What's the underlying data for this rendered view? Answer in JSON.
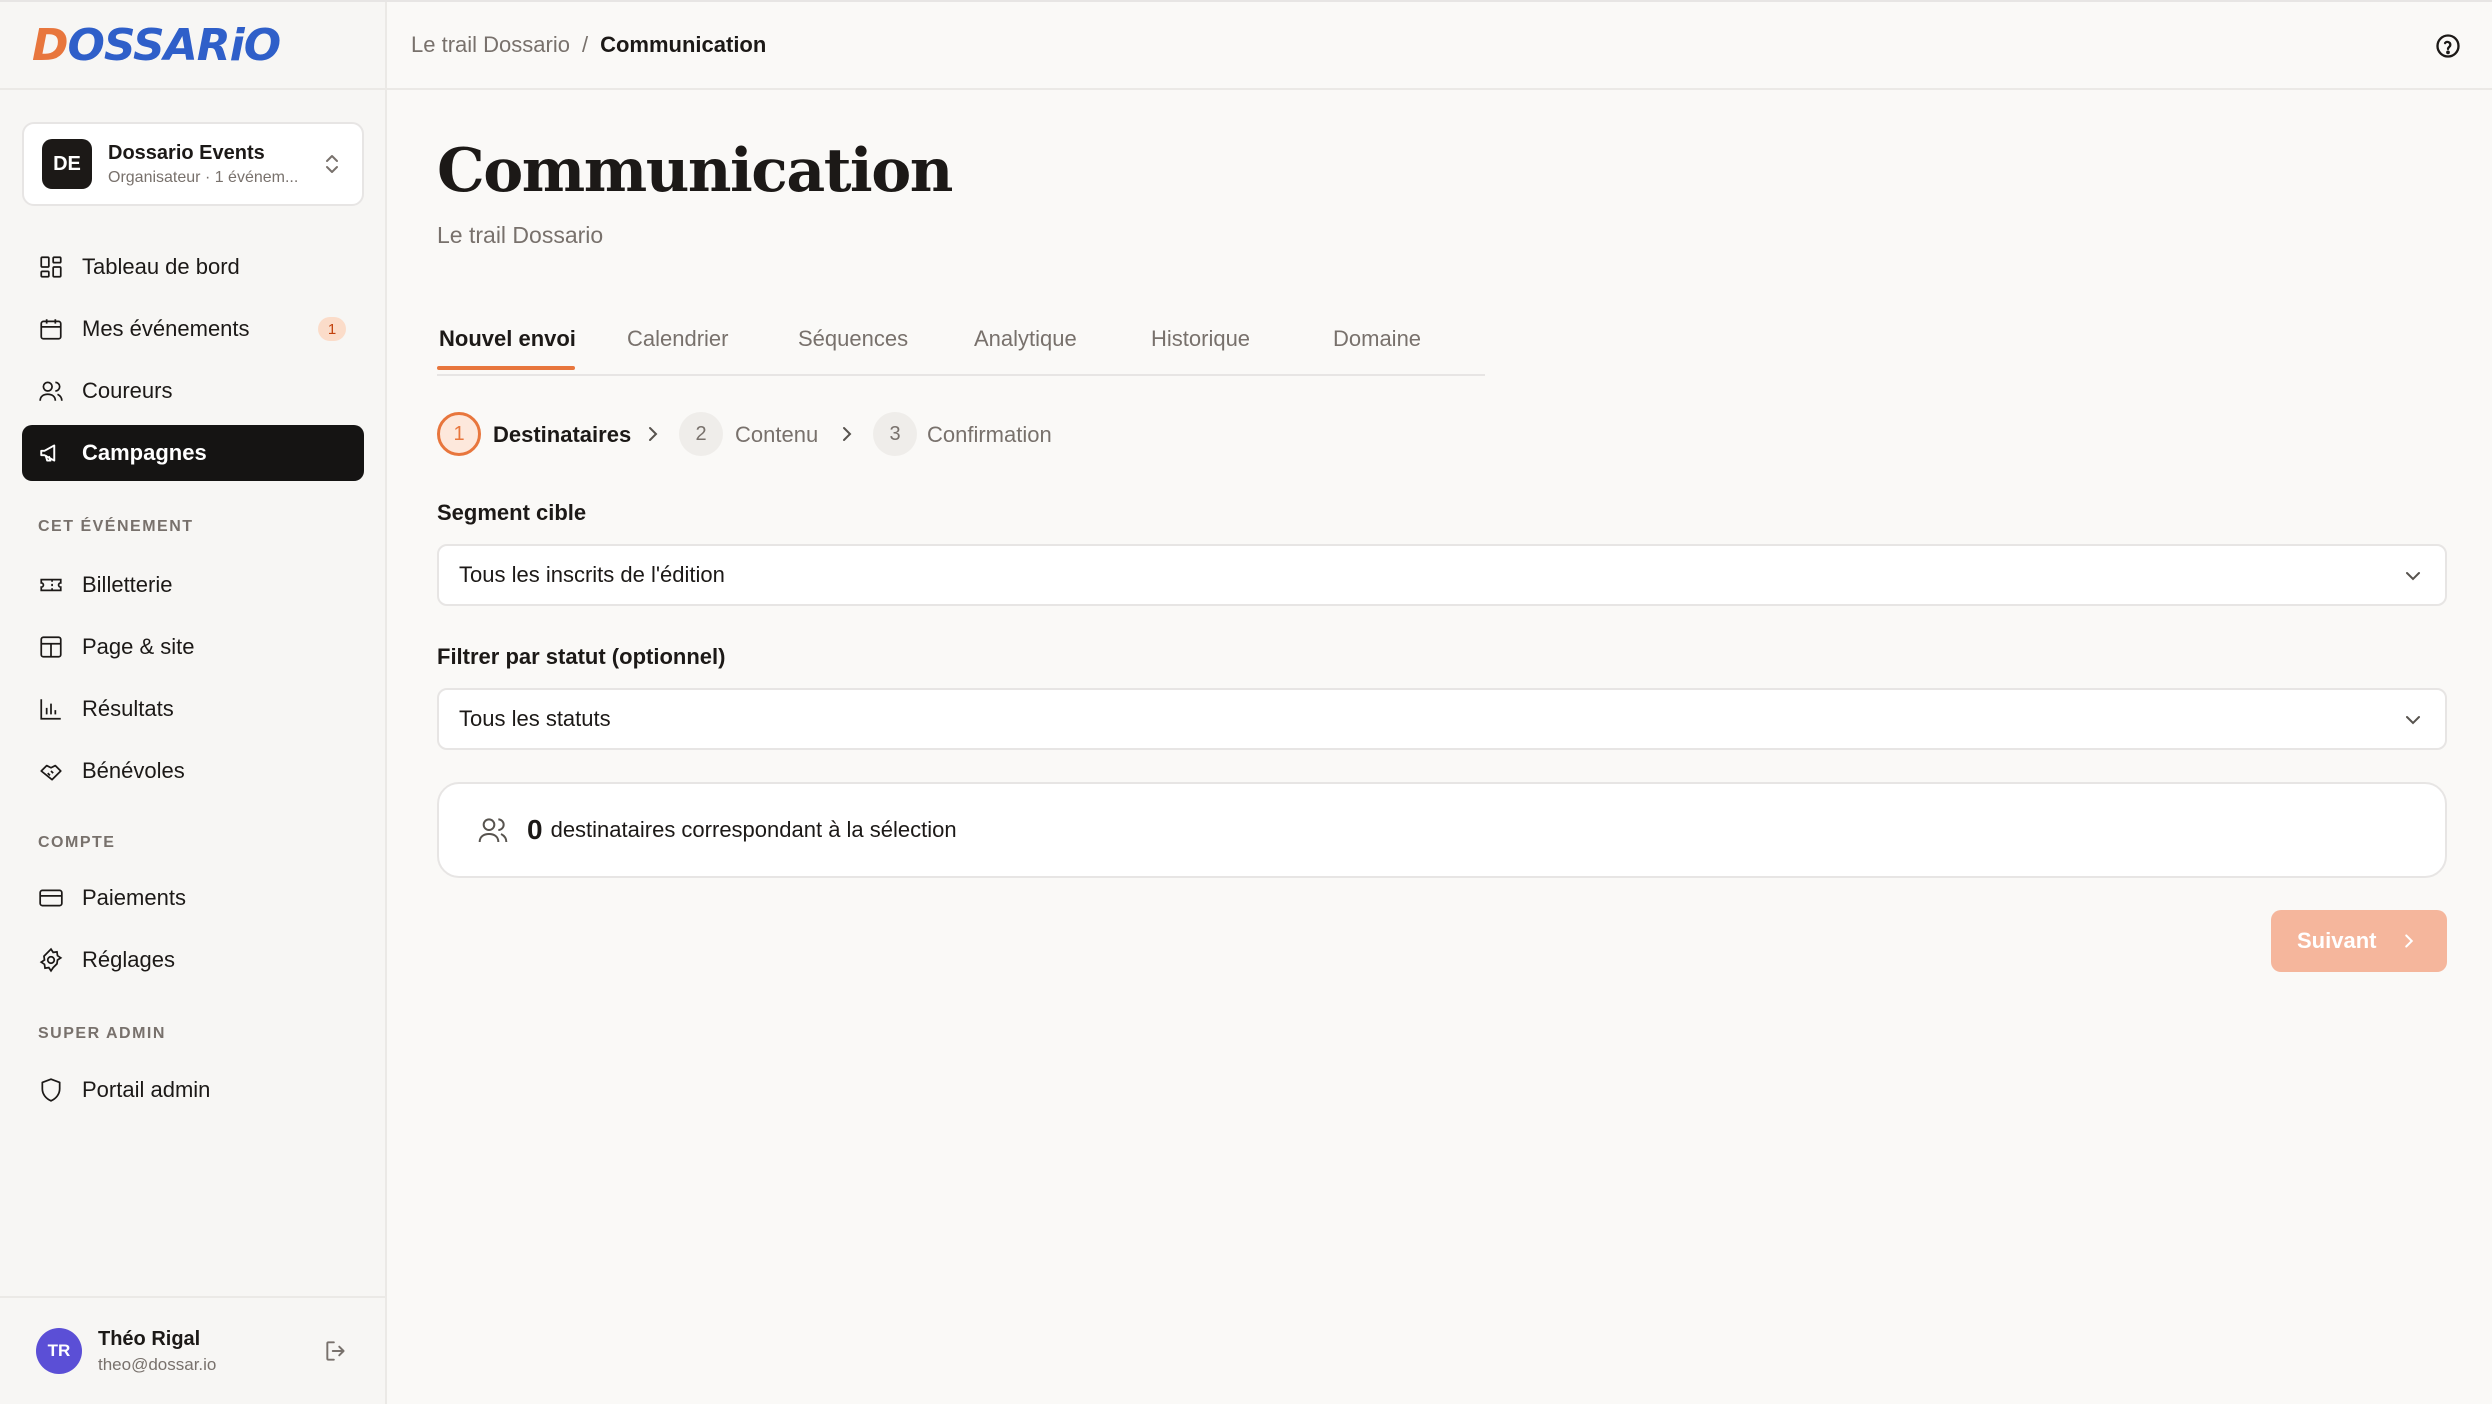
{
  "brand": {
    "logo_prefix": "D",
    "logo_rest": "OSSARiO"
  },
  "org": {
    "initials": "DE",
    "name": "Dossario Events",
    "subtitle": "Organisateur · 1 événem..."
  },
  "nav": {
    "main": [
      {
        "label": "Tableau de bord",
        "icon": "dashboard-icon"
      },
      {
        "label": "Mes événements",
        "icon": "calendar-icon",
        "badge": "1"
      },
      {
        "label": "Coureurs",
        "icon": "users-icon"
      },
      {
        "label": "Campagnes",
        "icon": "megaphone-icon",
        "active": true
      }
    ],
    "event_section_label": "CET ÉVÉNEMENT",
    "event": [
      {
        "label": "Billetterie",
        "icon": "ticket-icon"
      },
      {
        "label": "Page & site",
        "icon": "layout-icon"
      },
      {
        "label": "Résultats",
        "icon": "bar-chart-icon"
      },
      {
        "label": "Bénévoles",
        "icon": "handshake-icon"
      }
    ],
    "account_section_label": "COMPTE",
    "account": [
      {
        "label": "Paiements",
        "icon": "credit-card-icon"
      },
      {
        "label": "Réglages",
        "icon": "settings-icon"
      }
    ],
    "admin_section_label": "SUPER ADMIN",
    "admin": [
      {
        "label": "Portail admin",
        "icon": "shield-icon"
      }
    ]
  },
  "user": {
    "initials": "TR",
    "name": "Théo Rigal",
    "email": "theo@dossar.io"
  },
  "breadcrumb": {
    "parent": "Le trail Dossario",
    "separator": "/",
    "current": "Communication"
  },
  "page": {
    "title": "Communication",
    "subtitle": "Le trail Dossario"
  },
  "tabs": [
    "Nouvel envoi",
    "Calendrier",
    "Séquences",
    "Analytique",
    "Historique",
    "Domaine"
  ],
  "active_tab": "Nouvel envoi",
  "steps": [
    {
      "number": "1",
      "label": "Destinataires",
      "active": true
    },
    {
      "number": "2",
      "label": "Contenu"
    },
    {
      "number": "3",
      "label": "Confirmation"
    }
  ],
  "form": {
    "segment_label": "Segment cible",
    "segment_value": "Tous les inscrits de l'édition",
    "status_label": "Filtrer par statut (optionnel)",
    "status_value": "Tous les statuts"
  },
  "recipients": {
    "count": "0",
    "text": "destinataires correspondant à la sélection"
  },
  "next_button": "Suivant",
  "colors": {
    "accent": "#e8763d",
    "brand_blue": "#2f5fc9",
    "active_nav": "#151413",
    "next_disabled": "#f5b69c"
  }
}
